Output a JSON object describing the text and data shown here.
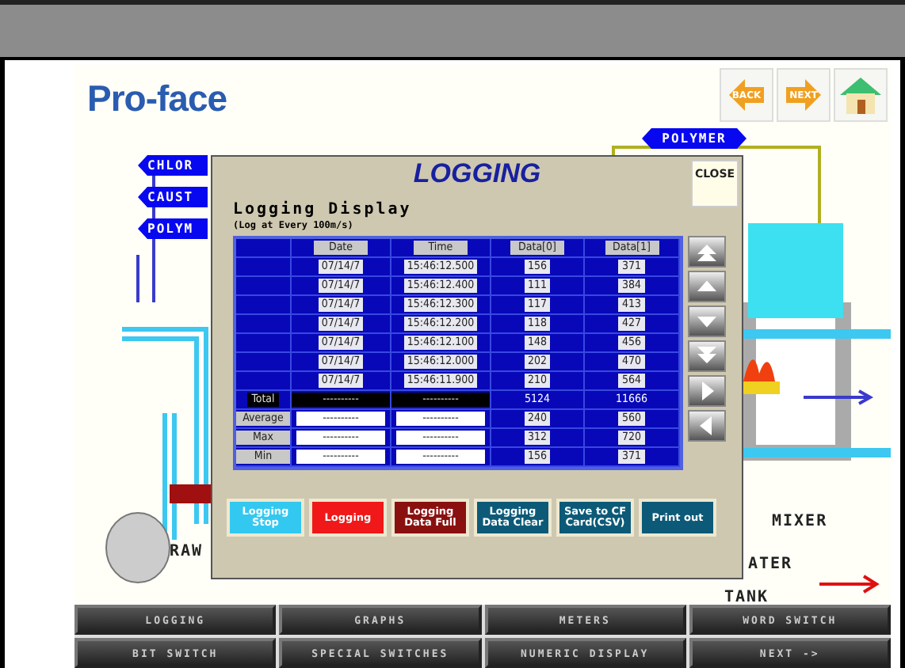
{
  "logo": "Pro-face",
  "nav_buttons": [
    {
      "kind": "back",
      "label": "BACK"
    },
    {
      "kind": "next",
      "label": "NEXT"
    },
    {
      "kind": "home"
    }
  ],
  "diagram": {
    "tags": [
      {
        "label": "CHLOR"
      },
      {
        "label": "CAUST"
      },
      {
        "label": "POLYM"
      }
    ],
    "polymer_tag": "POLYMER",
    "mixer_label": "MIXER",
    "raw_label": "RAW",
    "water_label": "ATER",
    "tank_label": "TANK"
  },
  "popup": {
    "title": "LOGGING",
    "close": "CLOSE",
    "heading": "Logging Display",
    "subheading": "(Log at Every 100m/s)",
    "columns": [
      "Date",
      "Time",
      "Data[0]",
      "Data[1]"
    ],
    "rows": [
      {
        "kind": "data",
        "date": "07/14/7",
        "time": "15:46:12.500",
        "d0": "156",
        "d1": "371"
      },
      {
        "kind": "data",
        "date": "07/14/7",
        "time": "15:46:12.400",
        "d0": "111",
        "d1": "384"
      },
      {
        "kind": "data",
        "date": "07/14/7",
        "time": "15:46:12.300",
        "d0": "117",
        "d1": "413"
      },
      {
        "kind": "data",
        "date": "07/14/7",
        "time": "15:46:12.200",
        "d0": "118",
        "d1": "427"
      },
      {
        "kind": "data",
        "date": "07/14/7",
        "time": "15:46:12.100",
        "d0": "148",
        "d1": "456"
      },
      {
        "kind": "data",
        "date": "07/14/7",
        "time": "15:46:12.000",
        "d0": "202",
        "d1": "470"
      },
      {
        "kind": "data",
        "date": "07/14/7",
        "time": "15:46:11.900",
        "d0": "210",
        "d1": "564"
      },
      {
        "kind": "total",
        "label": "Total",
        "date": "----------",
        "time": "----------",
        "d0": "5124",
        "d1": "11666"
      },
      {
        "kind": "stat",
        "label": "Average",
        "date": "----------",
        "time": "----------",
        "d0": "240",
        "d1": "560"
      },
      {
        "kind": "stat",
        "label": "Max",
        "date": "----------",
        "time": "----------",
        "d0": "312",
        "d1": "720"
      },
      {
        "kind": "stat",
        "label": "Min",
        "date": "----------",
        "time": "----------",
        "d0": "156",
        "d1": "371"
      }
    ],
    "scroll_buttons": [
      {
        "kind": "top"
      },
      {
        "kind": "up"
      },
      {
        "kind": "down"
      },
      {
        "kind": "bottom"
      },
      {
        "kind": "right"
      },
      {
        "kind": "left"
      }
    ],
    "buttons": [
      {
        "label": "Logging Stop",
        "color": "#33c8f0"
      },
      {
        "label": "Logging",
        "color": "#f01818"
      },
      {
        "label": "Logging Data Full",
        "color": "#8a1010"
      },
      {
        "label": "Logging Data Clear",
        "color": "#0c5a78"
      },
      {
        "label": "Save to CF Card(CSV)",
        "color": "#0c5a78"
      },
      {
        "label": "Print out",
        "color": "#0c5a78"
      }
    ]
  },
  "menu": [
    "LOGGING",
    "GRAPHS",
    "METERS",
    "WORD SWITCH",
    "BIT SWITCH",
    "SPECIAL SWITCHES",
    "NUMERIC DISPLAY",
    "NEXT ->"
  ]
}
